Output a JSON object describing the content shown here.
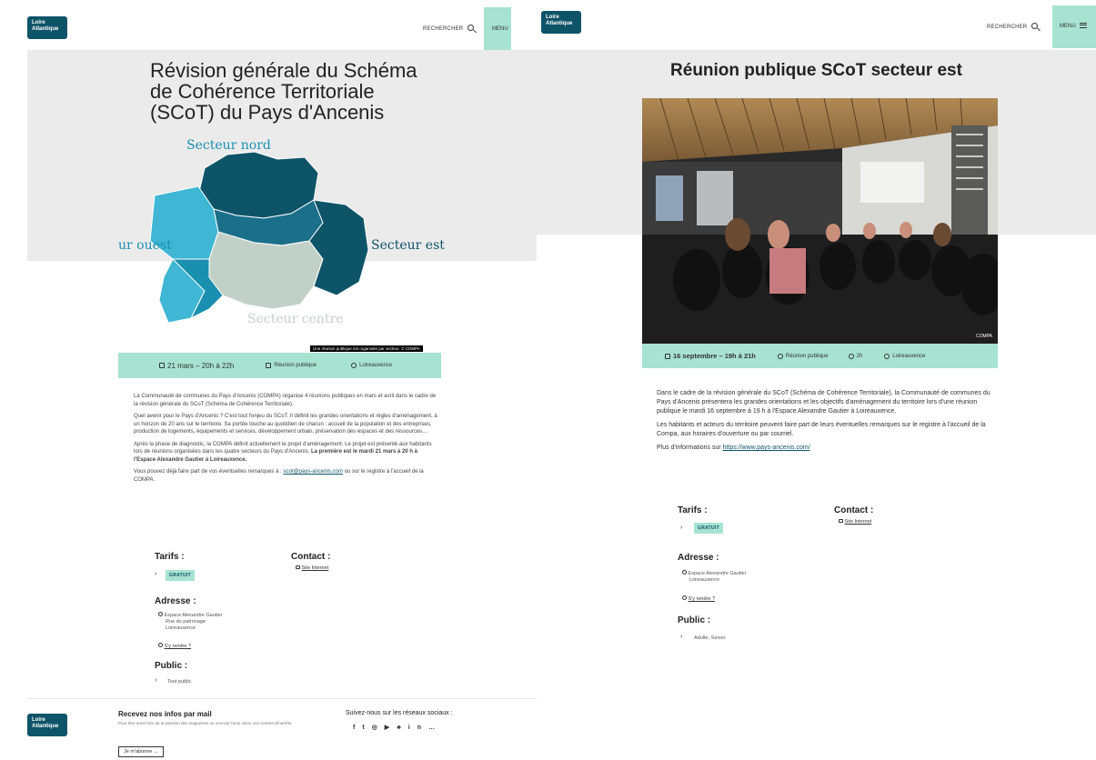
{
  "brand": {
    "logo_line1": "Loire",
    "logo_line2": "Atlantique"
  },
  "header": {
    "search_label": "RECHERCHER",
    "menu_label": "MENU"
  },
  "left": {
    "title": "Révision générale du Schéma de Cohérence Territoriale (SCoT) du Pays d'Ancenis",
    "map": {
      "labels": {
        "nord": "Secteur nord",
        "ouest": "ur ouest",
        "est": "Secteur est",
        "centre": "Secteur centre"
      },
      "caption": "Une réunion publique est organisée par secteur. © COMPA"
    },
    "info": {
      "date": "21 mars – 20h à 22h",
      "type": "Réunion publique",
      "place": "Loireauxence"
    },
    "paragraphs": [
      "La Communauté de communes du Pays d'Ancenis (COMPA) organise 4 réunions publiques en mars et avril dans le cadre de la révision générale du SCoT (Schéma de Cohérence Territoriale).",
      "Quel avenir pour le Pays d'Ancenis ? C'est tout l'enjeu du SCoT. Il définit les grandes orientations et règles d'aménagement, à un horizon de 20 ans sur le territoire. Sa portée touche au quotidien de chacun : accueil de la population et des entreprises, production de logements, équipements et services, développement urbain, préservation des espaces et des ressources…",
      "Après la phase de diagnostic, la COMPA définit actuellement le projet d'aménagement. Le projet est présenté aux habitants lors de réunions organisées dans les quatre secteurs du Pays d'Ancenis.",
      "Vous pouvez déjà faire part de vos éventuelles remarques à :"
    ],
    "bold_text": "La première est le mardi 21 mars à 20 h à l'Espace Alexandre Gautier à Loireauxence.",
    "email": "scot@pays-ancenis.com",
    "email_suffix": "ou sur le registre à l'accueil de la COMPA.",
    "tarifs_h": "Tarifs :",
    "tarif_badge": "GRATUIT",
    "contact_h": "Contact :",
    "contact_link": "Site Internet",
    "adresse_h": "Adresse :",
    "address_lines": [
      "Espace Alexandre Gautier",
      "Rue du patronage",
      "Loireauxence"
    ],
    "directions": "S'y rendre ?",
    "public_h": "Public :",
    "public_value": "Tout public"
  },
  "footer": {
    "news_title": "Recevez nos infos par mail",
    "news_desc": "Pour être averti lors de la parution des magazines ou recevoir l'actu selon vos centres d'intérêts.",
    "subscribe": "Je m'abonne",
    "social_title": "Suivez-nous sur les réseaux sociaux :",
    "social_icons": [
      "f",
      "t",
      "◎",
      "▶",
      "♣",
      "in",
      "…"
    ]
  },
  "right": {
    "title": "Réunion publique SCoT secteur est",
    "photo_credit": "COMPA",
    "info": {
      "date": "16 septembre – 19h à 21h",
      "type": "Réunion publique",
      "duration": "2h",
      "place": "Loireauxence"
    },
    "paragraphs": [
      "Dans le cadre de la révision générale du SCoT (Schéma de Cohérence Territoriale), la Communauté de communes du Pays d'Ancenis présentera les grandes orientations et les objectifs d'aménagement du territoire lors d'une réunion publique le mardi 16 septembre à 19 h à l'Espace Alexandre Gautier à Loireauxence.",
      "Les habitants et acteurs du territoire peuvent faire part de leurs éventuelles remarques sur le registre à l'accueil de la Compa, aux horaires d'ouverture ou par courriel."
    ],
    "more_info": "Plus d'informations sur",
    "more_link": "https://www.pays-ancenis.com/",
    "tarifs_h": "Tarifs :",
    "tarif_badge": "GRATUIT",
    "contact_h": "Contact :",
    "contact_link": "Site Internet",
    "adresse_h": "Adresse :",
    "address_lines": [
      "Espace Alexandre Gautier",
      "Loireauxence"
    ],
    "directions": "S'y rendre ?",
    "public_h": "Public :",
    "public_value": "Adulte, Senior"
  },
  "colors": {
    "accent": "#a7e3d0",
    "dark_teal": "#0e5468",
    "mid_teal": "#1b8fb0",
    "light_teal": "#3fb6d4",
    "sage": "#c2d1c7"
  }
}
